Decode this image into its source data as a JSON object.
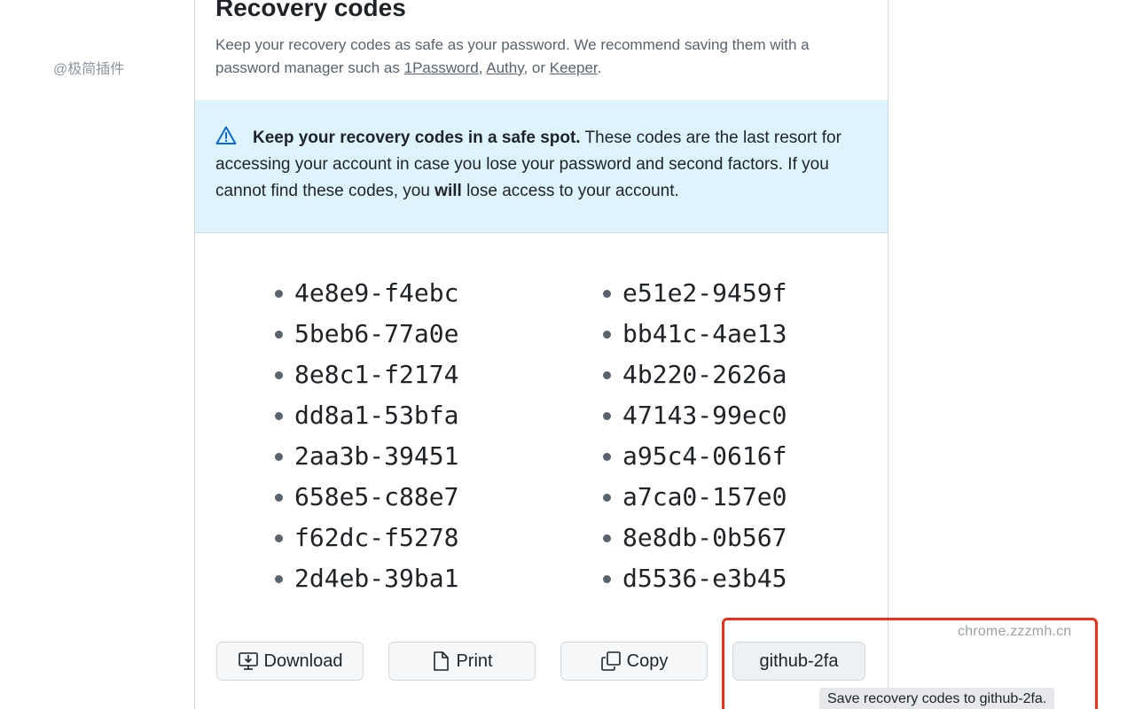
{
  "watermarks": {
    "left": "@极简插件",
    "right": "chrome.zzzmh.cn"
  },
  "header": {
    "title": "Recovery codes",
    "desc_prefix": "Keep your recovery codes as safe as your password. We recommend saving them with a password manager such as ",
    "link_1password": "1Password",
    "sep1": ", ",
    "link_authy": "Authy",
    "sep2": ", or ",
    "link_keeper": "Keeper",
    "desc_suffix": "."
  },
  "alert": {
    "icon": "alert-triangle-icon",
    "bold_text": "Keep your recovery codes in a safe spot.",
    "text_part1": " These codes are the last resort for accessing your account in case you lose your password and second factors. If you cannot find these codes, you ",
    "bold_will": "will",
    "text_part2": " lose access to your account."
  },
  "codes": {
    "left": [
      "4e8e9-f4ebc",
      "5beb6-77a0e",
      "8e8c1-f2174",
      "dd8a1-53bfa",
      "2aa3b-39451",
      "658e5-c88e7",
      "f62dc-f5278",
      "2d4eb-39ba1"
    ],
    "right": [
      "e51e2-9459f",
      "bb41c-4ae13",
      "4b220-2626a",
      "47143-99ec0",
      "a95c4-0616f",
      "a7ca0-157e0",
      "8e8db-0b567",
      "d5536-e3b45"
    ]
  },
  "buttons": {
    "download": "Download",
    "print": "Print",
    "copy": "Copy",
    "github": "github-2fa"
  },
  "tooltip": "Save recovery codes to github-2fa.",
  "colors": {
    "alert_bg": "#ddf4ff",
    "accent": "#0969da",
    "highlight": "#e8321d"
  }
}
